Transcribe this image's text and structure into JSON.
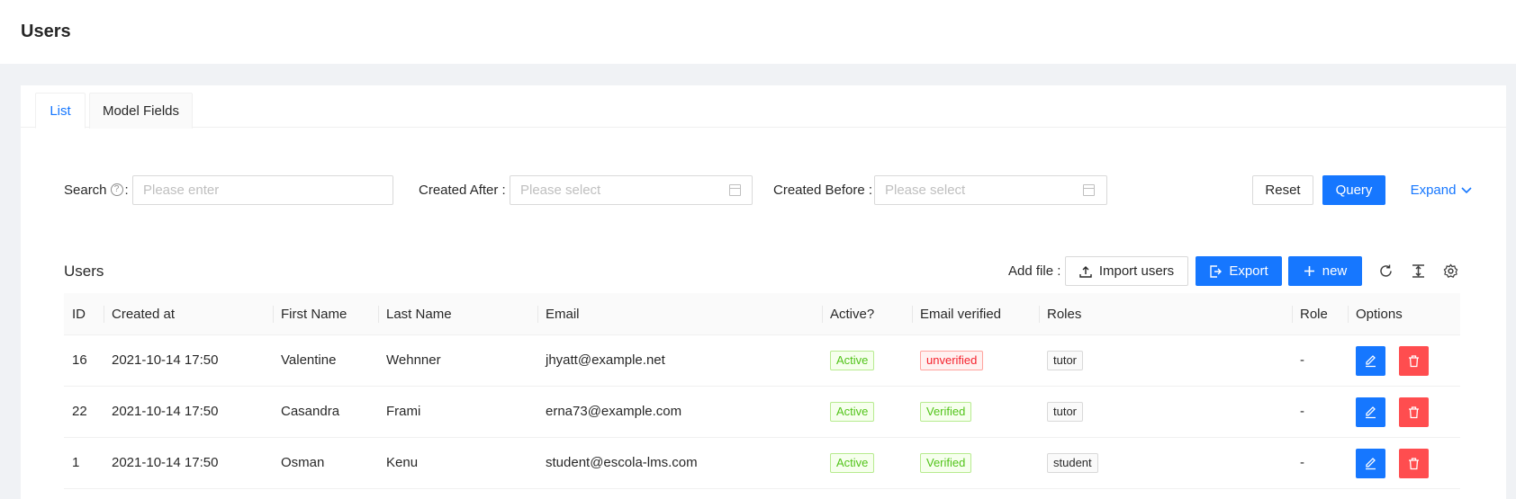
{
  "header": {
    "title": "Users"
  },
  "tabs": [
    {
      "label": "List",
      "active": true
    },
    {
      "label": "Model Fields",
      "active": false
    }
  ],
  "filters": {
    "search": {
      "label": "Search",
      "placeholder": "Please enter"
    },
    "created_after": {
      "label": "Created After",
      "placeholder": "Please select"
    },
    "created_before": {
      "label": "Created Before",
      "placeholder": "Please select"
    },
    "reset_label": "Reset",
    "query_label": "Query",
    "expand_label": "Expand"
  },
  "table_toolbar": {
    "title": "Users",
    "add_file_label": "Add file",
    "import_label": "Import users",
    "export_label": "Export",
    "new_label": "new",
    "icons": [
      "reload-icon",
      "column-height-icon",
      "settings-icon"
    ]
  },
  "table": {
    "columns": [
      "ID",
      "Created at",
      "First Name",
      "Last Name",
      "Email",
      "Active?",
      "Email verified",
      "Roles",
      "Role",
      "Options"
    ],
    "rows": [
      {
        "id": "16",
        "created_at": "2021-10-14 17:50",
        "first_name": "Valentine",
        "last_name": "Wehnner",
        "email": "jhyatt@example.net",
        "active": "Active",
        "email_verified": "unverified",
        "roles": "tutor",
        "role": "-"
      },
      {
        "id": "22",
        "created_at": "2021-10-14 17:50",
        "first_name": "Casandra",
        "last_name": "Frami",
        "email": "erna73@example.com",
        "active": "Active",
        "email_verified": "Verified",
        "roles": "tutor",
        "role": "-"
      },
      {
        "id": "1",
        "created_at": "2021-10-14 17:50",
        "first_name": "Osman",
        "last_name": "Kenu",
        "email": "student@escola-lms.com",
        "active": "Active",
        "email_verified": "Verified",
        "roles": "student",
        "role": "-"
      }
    ]
  },
  "colors": {
    "primary": "#1677ff",
    "danger": "#ff4d4f",
    "success": "#52c41a",
    "background": "#f0f2f5"
  }
}
